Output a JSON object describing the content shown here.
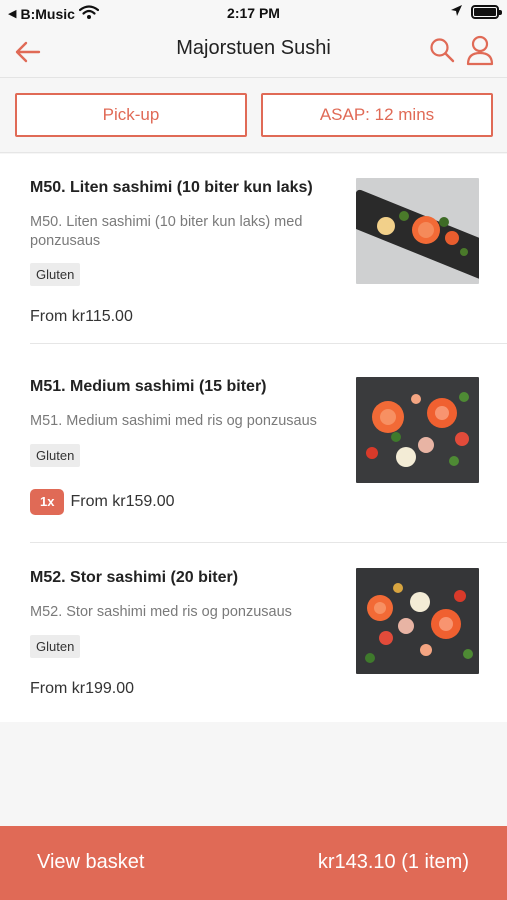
{
  "status_bar": {
    "carrier": "B:Music",
    "time": "2:17 PM",
    "icons": [
      "back-to-app-icon",
      "wifi-icon",
      "location-arrow-icon",
      "battery-icon"
    ]
  },
  "nav": {
    "title": "Majorstuen Sushi",
    "icons": [
      "back-arrow-icon",
      "search-icon",
      "user-icon"
    ]
  },
  "options": {
    "pickup_label": "Pick-up",
    "time_label": "ASAP: 12 mins"
  },
  "menu_items": [
    {
      "title": "M50. Liten sashimi (10 biter kun laks)",
      "description": "M50. Liten sashimi (10 biter kun laks) med ponzusaus",
      "tag": "Gluten",
      "price": "From kr115.00",
      "quantity": ""
    },
    {
      "title": "M51. Medium sashimi (15 biter)",
      "description": "M51. Medium sashimi med ris og ponzusaus",
      "tag": "Gluten",
      "price": "From kr159.00",
      "quantity": "1x"
    },
    {
      "title": "M52. Stor sashimi (20 biter)",
      "description": "M52. Stor sashimi med ris og ponzusaus",
      "tag": "Gluten",
      "price": "From kr199.00",
      "quantity": ""
    }
  ],
  "basket": {
    "label": "View basket",
    "total": "kr143.10 (1 item)"
  },
  "colors": {
    "accent": "#e06a56",
    "background": "#f6f6f6",
    "card": "#ffffff",
    "muted_text": "#7a7a7a"
  }
}
